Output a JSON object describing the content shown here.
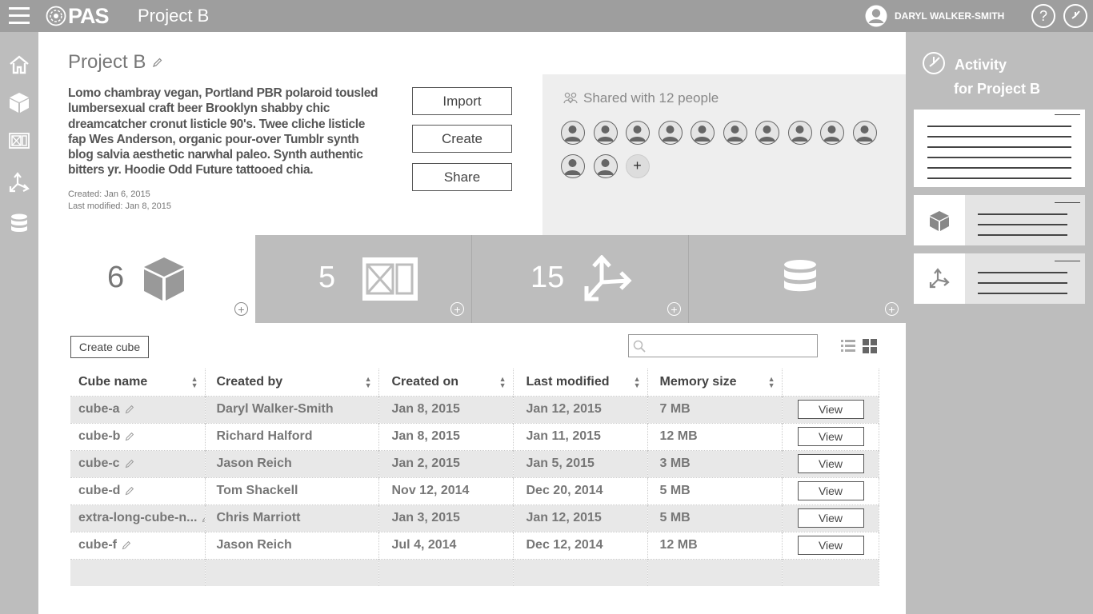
{
  "topbar": {
    "brand": "PAS",
    "app_title": "Project B",
    "user_name": "DARYL WALKER-SMITH",
    "help_icon": "question-icon",
    "status_icon": "clock-check-icon"
  },
  "leftnav": {
    "items": [
      {
        "name": "home",
        "icon": "home-icon"
      },
      {
        "name": "cubes",
        "icon": "cube-icon"
      },
      {
        "name": "views",
        "icon": "view-icon"
      },
      {
        "name": "dimensions",
        "icon": "axes-icon"
      },
      {
        "name": "datasources",
        "icon": "database-icon"
      }
    ]
  },
  "project": {
    "title": "Project B",
    "description": "Lomo chambray vegan, Portland PBR polaroid tousled lumbersexual craft beer Brooklyn shabby chic dreamcatcher cronut listicle 90's. Twee cliche listicle fap Wes Anderson, organic pour-over Tumblr synth blog salvia aesthetic narwhal paleo. Synth authentic bitters yr. Hoodie Odd Future tattooed chia.",
    "created": "Created: Jan 6, 2015",
    "modified": "Last modified: Jan 8, 2015",
    "actions": {
      "import": "Import",
      "create": "Create",
      "share": "Share"
    }
  },
  "shared": {
    "label": "Shared with 12 people",
    "count": 12
  },
  "tiles": [
    {
      "count": "6",
      "icon": "cube-icon"
    },
    {
      "count": "5",
      "icon": "view-icon"
    },
    {
      "count": "15",
      "icon": "axes-icon"
    },
    {
      "count": "",
      "icon": "database-icon"
    }
  ],
  "toolbar": {
    "create_label": "Create cube",
    "search_placeholder": "",
    "search_value": ""
  },
  "table": {
    "headers": [
      "Cube name",
      "Created by",
      "Created on",
      "Last modified",
      "Memory size"
    ],
    "rows": [
      {
        "name": "cube-a",
        "by": "Daryl Walker-Smith",
        "on": "Jan 8, 2015",
        "mod": "Jan 12, 2015",
        "size": "7 MB",
        "action": "View"
      },
      {
        "name": "cube-b",
        "by": "Richard Halford",
        "on": "Jan 8, 2015",
        "mod": "Jan 11, 2015",
        "size": "12 MB",
        "action": "View"
      },
      {
        "name": "cube-c",
        "by": "Jason Reich",
        "on": "Jan 2, 2015",
        "mod": "Jan 5, 2015",
        "size": "3 MB",
        "action": "View"
      },
      {
        "name": "cube-d",
        "by": "Tom Shackell",
        "on": "Nov 12, 2014",
        "mod": "Dec 20, 2014",
        "size": "5 MB",
        "action": "View"
      },
      {
        "name": "extra-long-cube-n...",
        "by": "Chris Marriott",
        "on": "Jan 3, 2015",
        "mod": "Jan 12, 2015",
        "size": "5 MB",
        "action": "View"
      },
      {
        "name": "cube-f",
        "by": "Jason Reich",
        "on": "Jul 4, 2014",
        "mod": "Dec 12, 2014",
        "size": "12 MB",
        "action": "View"
      }
    ]
  },
  "activity": {
    "title": "Activity",
    "subtitle": "for Project B"
  }
}
